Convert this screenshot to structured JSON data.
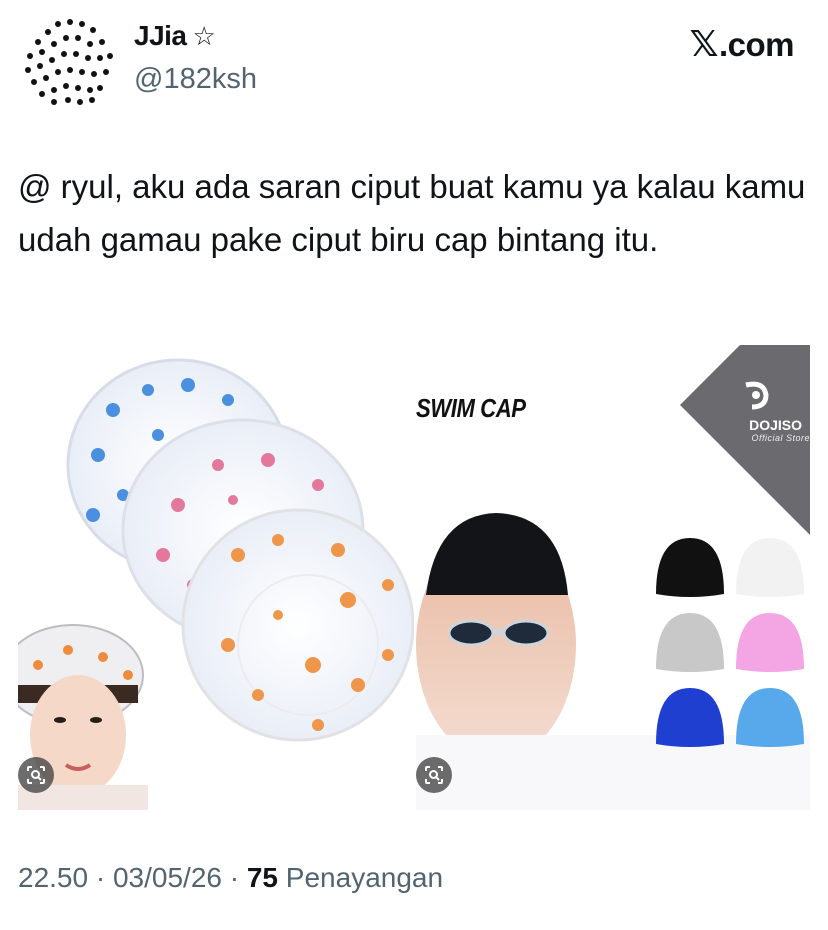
{
  "header": {
    "display_name": "JJia",
    "badge_icon": "star-outline-icon",
    "handle": "@182ksh",
    "brand": ".com",
    "brand_icon": "x-logo-icon"
  },
  "tweet": {
    "text": "@ ryul, aku ada saran ciput buat kamu ya kalau kamu udah gamau pake ciput biru cap bintang itu."
  },
  "media": {
    "right_title": "SWIM CAP",
    "right_brand": "DOJISO",
    "right_brand_sub": "Official Store",
    "lens_icon": "visual-search-icon",
    "cap_colors": [
      "#111111",
      "#f2f2f2",
      "#c8c8c8",
      "#f3a6e3",
      "#1e3fd0",
      "#58a8ec"
    ]
  },
  "meta": {
    "time": "22.50",
    "date": "03/05/26",
    "views_count": "75",
    "views_label": "Penayangan"
  }
}
